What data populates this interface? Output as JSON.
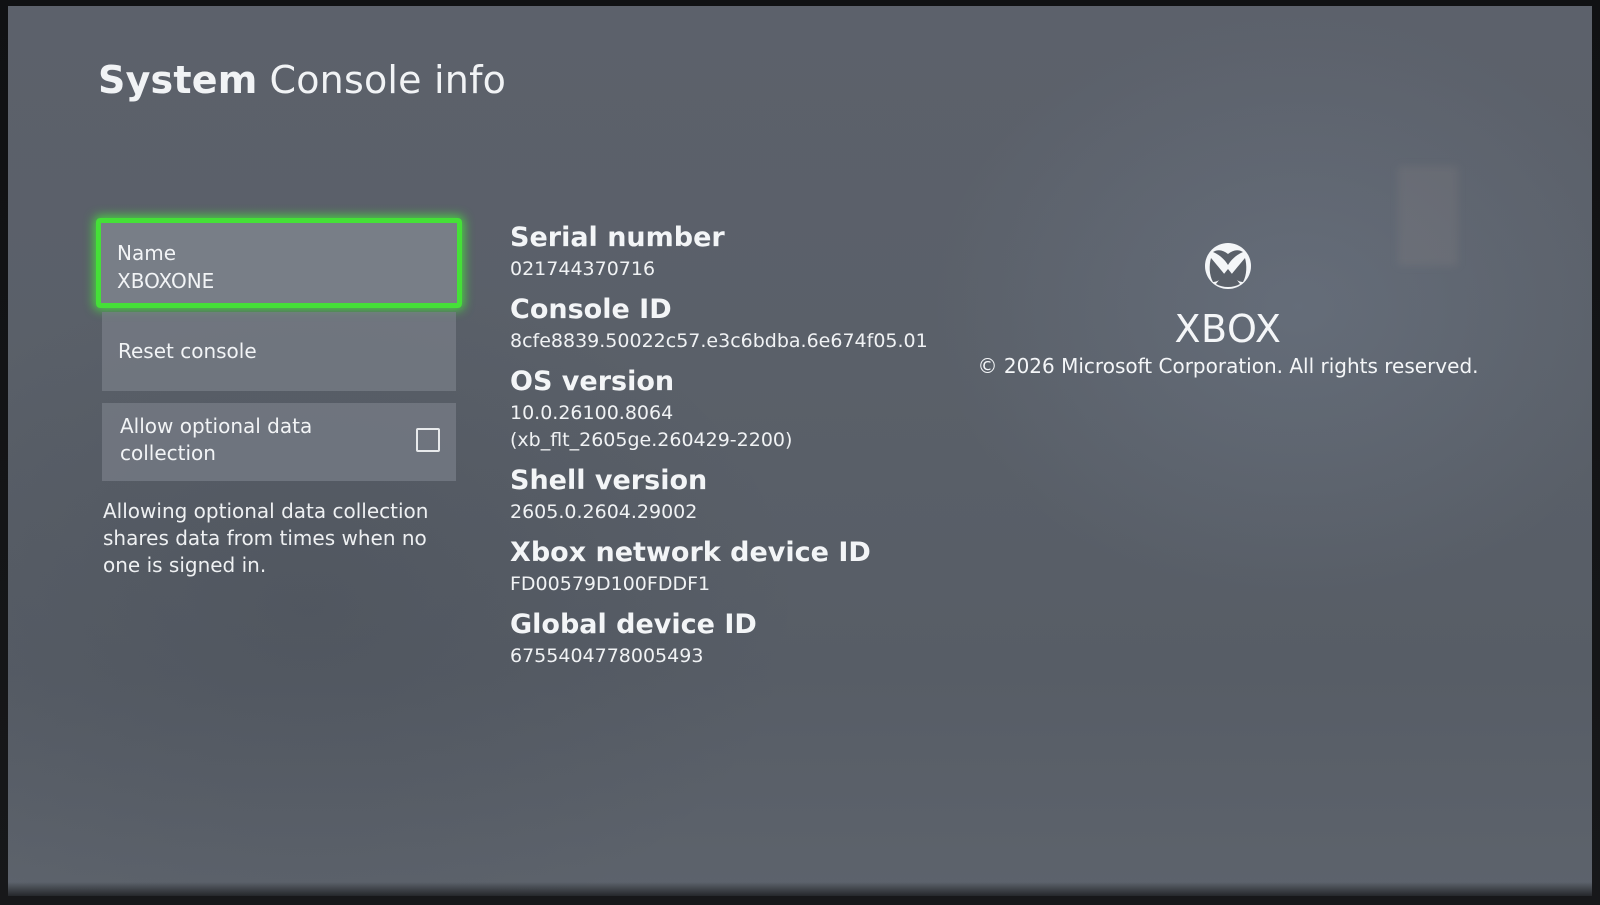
{
  "header": {
    "breadcrumb": "System",
    "title": "Console info"
  },
  "menu": {
    "name": {
      "label": "Name",
      "value": "XBOXONE"
    },
    "reset": {
      "label": "Reset console"
    },
    "data_collection": {
      "label": "Allow optional data collection",
      "checked": false,
      "help": "Allowing optional data collection shares data from times when no one is signed in."
    }
  },
  "info": [
    {
      "label": "Serial number",
      "value": "021744370716"
    },
    {
      "label": "Console ID",
      "value": "8cfe8839.50022c57.e3c6bdba.6e674f05.01"
    },
    {
      "label": "OS version",
      "value": "10.0.26100.8064",
      "value2": "(xb_flt_2605ge.260429-2200)"
    },
    {
      "label": "Shell version",
      "value": "2605.0.2604.29002"
    },
    {
      "label": "Xbox network device ID",
      "value": "FD00579D100FDDF1"
    },
    {
      "label": "Global device ID",
      "value": "6755404778005493"
    }
  ],
  "brand": {
    "icon": "xbox-logo-icon",
    "name": "XBOX",
    "copyright": "© 2026 Microsoft Corporation. All rights reserved."
  },
  "colors": {
    "focus": "#45e038",
    "text": "#f2f4f6"
  }
}
